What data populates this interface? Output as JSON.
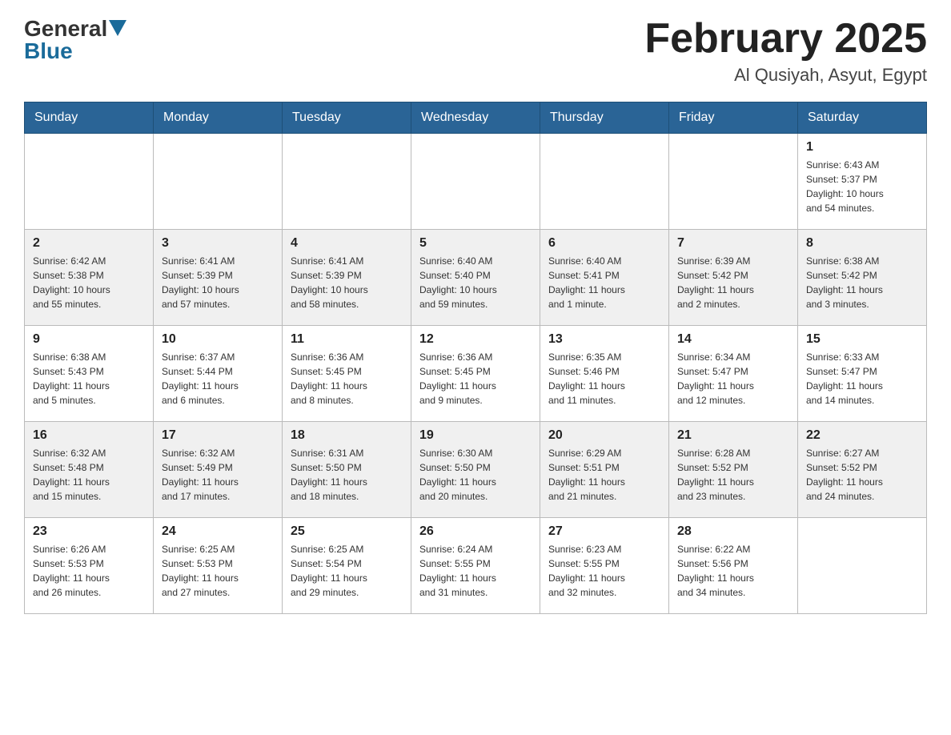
{
  "header": {
    "logo_general": "General",
    "logo_blue": "Blue",
    "month_year": "February 2025",
    "location": "Al Qusiyah, Asyut, Egypt"
  },
  "weekdays": [
    "Sunday",
    "Monday",
    "Tuesday",
    "Wednesday",
    "Thursday",
    "Friday",
    "Saturday"
  ],
  "weeks": [
    {
      "days": [
        {
          "number": "",
          "info": ""
        },
        {
          "number": "",
          "info": ""
        },
        {
          "number": "",
          "info": ""
        },
        {
          "number": "",
          "info": ""
        },
        {
          "number": "",
          "info": ""
        },
        {
          "number": "",
          "info": ""
        },
        {
          "number": "1",
          "info": "Sunrise: 6:43 AM\nSunset: 5:37 PM\nDaylight: 10 hours\nand 54 minutes."
        }
      ]
    },
    {
      "days": [
        {
          "number": "2",
          "info": "Sunrise: 6:42 AM\nSunset: 5:38 PM\nDaylight: 10 hours\nand 55 minutes."
        },
        {
          "number": "3",
          "info": "Sunrise: 6:41 AM\nSunset: 5:39 PM\nDaylight: 10 hours\nand 57 minutes."
        },
        {
          "number": "4",
          "info": "Sunrise: 6:41 AM\nSunset: 5:39 PM\nDaylight: 10 hours\nand 58 minutes."
        },
        {
          "number": "5",
          "info": "Sunrise: 6:40 AM\nSunset: 5:40 PM\nDaylight: 10 hours\nand 59 minutes."
        },
        {
          "number": "6",
          "info": "Sunrise: 6:40 AM\nSunset: 5:41 PM\nDaylight: 11 hours\nand 1 minute."
        },
        {
          "number": "7",
          "info": "Sunrise: 6:39 AM\nSunset: 5:42 PM\nDaylight: 11 hours\nand 2 minutes."
        },
        {
          "number": "8",
          "info": "Sunrise: 6:38 AM\nSunset: 5:42 PM\nDaylight: 11 hours\nand 3 minutes."
        }
      ]
    },
    {
      "days": [
        {
          "number": "9",
          "info": "Sunrise: 6:38 AM\nSunset: 5:43 PM\nDaylight: 11 hours\nand 5 minutes."
        },
        {
          "number": "10",
          "info": "Sunrise: 6:37 AM\nSunset: 5:44 PM\nDaylight: 11 hours\nand 6 minutes."
        },
        {
          "number": "11",
          "info": "Sunrise: 6:36 AM\nSunset: 5:45 PM\nDaylight: 11 hours\nand 8 minutes."
        },
        {
          "number": "12",
          "info": "Sunrise: 6:36 AM\nSunset: 5:45 PM\nDaylight: 11 hours\nand 9 minutes."
        },
        {
          "number": "13",
          "info": "Sunrise: 6:35 AM\nSunset: 5:46 PM\nDaylight: 11 hours\nand 11 minutes."
        },
        {
          "number": "14",
          "info": "Sunrise: 6:34 AM\nSunset: 5:47 PM\nDaylight: 11 hours\nand 12 minutes."
        },
        {
          "number": "15",
          "info": "Sunrise: 6:33 AM\nSunset: 5:47 PM\nDaylight: 11 hours\nand 14 minutes."
        }
      ]
    },
    {
      "days": [
        {
          "number": "16",
          "info": "Sunrise: 6:32 AM\nSunset: 5:48 PM\nDaylight: 11 hours\nand 15 minutes."
        },
        {
          "number": "17",
          "info": "Sunrise: 6:32 AM\nSunset: 5:49 PM\nDaylight: 11 hours\nand 17 minutes."
        },
        {
          "number": "18",
          "info": "Sunrise: 6:31 AM\nSunset: 5:50 PM\nDaylight: 11 hours\nand 18 minutes."
        },
        {
          "number": "19",
          "info": "Sunrise: 6:30 AM\nSunset: 5:50 PM\nDaylight: 11 hours\nand 20 minutes."
        },
        {
          "number": "20",
          "info": "Sunrise: 6:29 AM\nSunset: 5:51 PM\nDaylight: 11 hours\nand 21 minutes."
        },
        {
          "number": "21",
          "info": "Sunrise: 6:28 AM\nSunset: 5:52 PM\nDaylight: 11 hours\nand 23 minutes."
        },
        {
          "number": "22",
          "info": "Sunrise: 6:27 AM\nSunset: 5:52 PM\nDaylight: 11 hours\nand 24 minutes."
        }
      ]
    },
    {
      "days": [
        {
          "number": "23",
          "info": "Sunrise: 6:26 AM\nSunset: 5:53 PM\nDaylight: 11 hours\nand 26 minutes."
        },
        {
          "number": "24",
          "info": "Sunrise: 6:25 AM\nSunset: 5:53 PM\nDaylight: 11 hours\nand 27 minutes."
        },
        {
          "number": "25",
          "info": "Sunrise: 6:25 AM\nSunset: 5:54 PM\nDaylight: 11 hours\nand 29 minutes."
        },
        {
          "number": "26",
          "info": "Sunrise: 6:24 AM\nSunset: 5:55 PM\nDaylight: 11 hours\nand 31 minutes."
        },
        {
          "number": "27",
          "info": "Sunrise: 6:23 AM\nSunset: 5:55 PM\nDaylight: 11 hours\nand 32 minutes."
        },
        {
          "number": "28",
          "info": "Sunrise: 6:22 AM\nSunset: 5:56 PM\nDaylight: 11 hours\nand 34 minutes."
        },
        {
          "number": "",
          "info": ""
        }
      ]
    }
  ]
}
